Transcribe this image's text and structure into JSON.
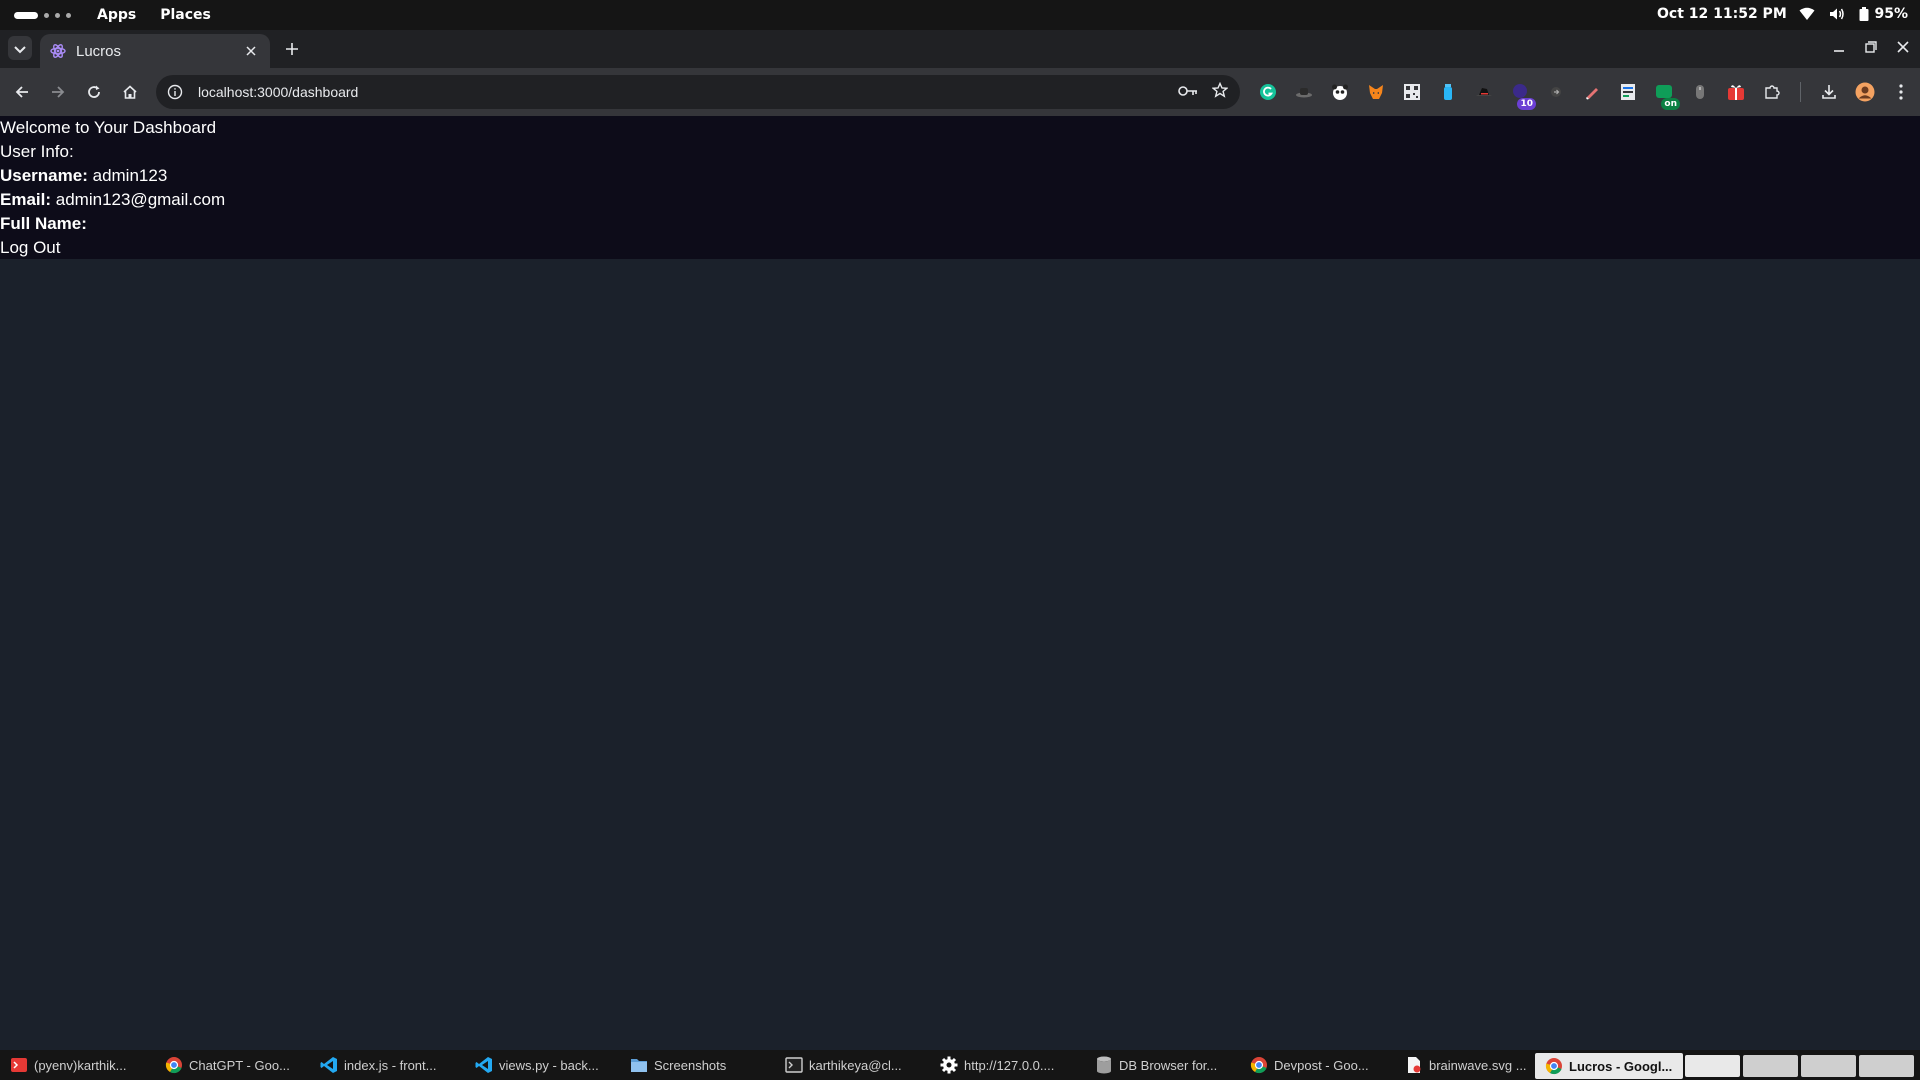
{
  "top_bar": {
    "menus": [
      "Apps",
      "Places"
    ],
    "clock": "Oct 12  11:52 PM",
    "battery": "95%",
    "icons": [
      "wifi-icon",
      "volume-icon",
      "battery-icon"
    ]
  },
  "browser": {
    "tab": {
      "title": "Lucros",
      "favicon": "atom-icon"
    },
    "url": "localhost:3000/dashboard",
    "extensions": [
      "grammarly",
      "hat",
      "panda",
      "metamask",
      "qr",
      "bottle",
      "hat2",
      "badge-10",
      "arrow",
      "pen",
      "sheet",
      "badge-on",
      "mouse",
      "gift",
      "puzzle"
    ],
    "badges": {
      "ten": "10",
      "on": "on"
    }
  },
  "dashboard": {
    "heading": "Welcome to Your Dashboard",
    "user_info_label": "User Info:",
    "username_label": "Username:",
    "username": "admin123",
    "email_label": "Email:",
    "email": "admin123@gmail.com",
    "fullname_label": "Full Name:",
    "fullname": "",
    "logout_label": "Log Out"
  },
  "taskbar": {
    "items": [
      {
        "label": "(pyenv)karthik...",
        "icon": "terminal-red-icon"
      },
      {
        "label": "ChatGPT - Goo...",
        "icon": "chrome-icon"
      },
      {
        "label": "index.js - front...",
        "icon": "vscode-icon"
      },
      {
        "label": "views.py - back...",
        "icon": "vscode-icon"
      },
      {
        "label": "Screenshots",
        "icon": "folder-icon"
      },
      {
        "label": "karthikeya@cl...",
        "icon": "terminal-icon"
      },
      {
        "label": "http://127.0.0....",
        "icon": "gear-icon"
      },
      {
        "label": "DB Browser for...",
        "icon": "database-icon"
      },
      {
        "label": "Devpost - Goo...",
        "icon": "chrome-icon"
      },
      {
        "label": "brainwave.svg ...",
        "icon": "file-icon"
      },
      {
        "label": "Lucros - Googl...",
        "icon": "chrome-icon"
      }
    ]
  }
}
